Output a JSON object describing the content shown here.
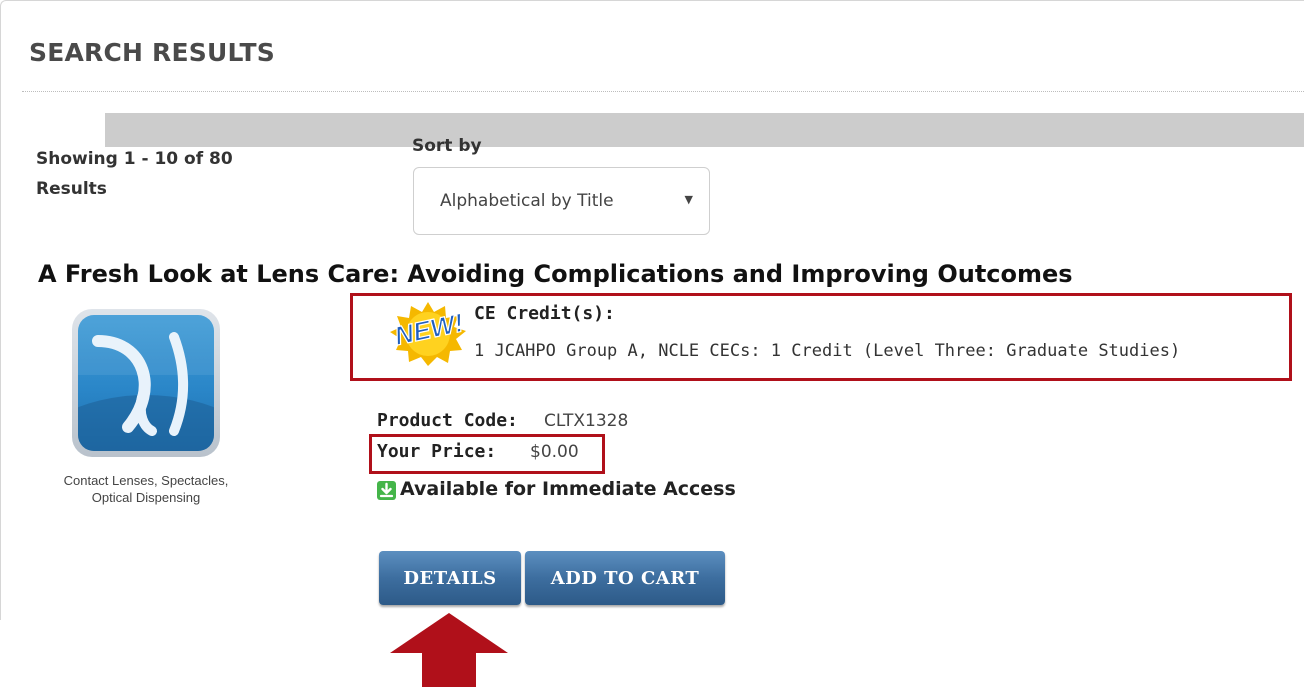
{
  "page": {
    "heading": "SEARCH RESULTS"
  },
  "results": {
    "count_text": "Showing 1 - 10 of 80 Results"
  },
  "sort": {
    "label": "Sort by",
    "selected": "Alphabetical by Title"
  },
  "product": {
    "title": "A Fresh Look at Lens Care: Avoiding Complications and Improving Outcomes",
    "category_caption": "Contact Lenses, Spectacles, Optical Dispensing",
    "new_badge": "NEW!",
    "credit_label": "CE Credit(s):",
    "credit_text": "1 JCAHPO Group A, NCLE CECs: 1 Credit (Level Three: Graduate Studies)",
    "code_label": "Product Code:",
    "code_value": "CLTX1328",
    "price_label": "Your Price:",
    "price_value": "$0.00",
    "availability": "Available for Immediate Access"
  },
  "buttons": {
    "details": "DETAILS",
    "add_to_cart": "ADD TO CART"
  },
  "colors": {
    "highlight": "#b0101a",
    "button": "#3d6e9f",
    "available_icon": "#44b549",
    "sort_bar": "#cccccc"
  },
  "icons": {
    "caret": "caret-down-icon",
    "available": "download-icon",
    "thumb": "lens-category-icon",
    "arrow": "arrow-up-icon"
  }
}
